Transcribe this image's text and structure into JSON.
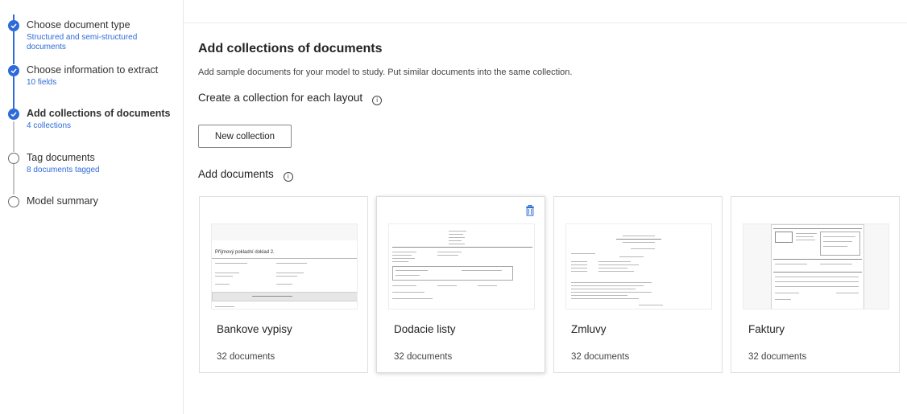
{
  "steps": [
    {
      "title": "Choose document type",
      "sub": "Structured and semi-structured documents",
      "done": true
    },
    {
      "title": "Choose information to extract",
      "sub": "10 fields",
      "done": true
    },
    {
      "title": "Add collections of documents",
      "sub": "4 collections",
      "done": true
    },
    {
      "title": "Tag documents",
      "sub": "8 documents tagged",
      "done": false
    },
    {
      "title": "Model summary",
      "sub": "",
      "done": false
    }
  ],
  "main": {
    "title": "Add collections of documents",
    "description": "Add sample documents for your model to study. Put similar documents into the same collection.",
    "create_heading": "Create a collection for each layout",
    "new_collection_label": "New collection",
    "add_documents_heading": "Add documents",
    "info_glyph": "i"
  },
  "collections": [
    {
      "name": "Bankove vypisy",
      "count": "32 documents",
      "thumb_text": "Příjmový pokladní doklad 2."
    },
    {
      "name": "Dodacie listy",
      "count": "32 documents"
    },
    {
      "name": "Zmluvy",
      "count": "32 documents"
    },
    {
      "name": "Faktury",
      "count": "32 documents"
    }
  ],
  "colors": {
    "accent": "#2f6bd8",
    "border": "#e1dfdd"
  },
  "icons": {
    "done": "checkmark-circle-icon",
    "todo": "empty-circle-icon",
    "info": "info-icon",
    "delete": "trash-icon"
  }
}
